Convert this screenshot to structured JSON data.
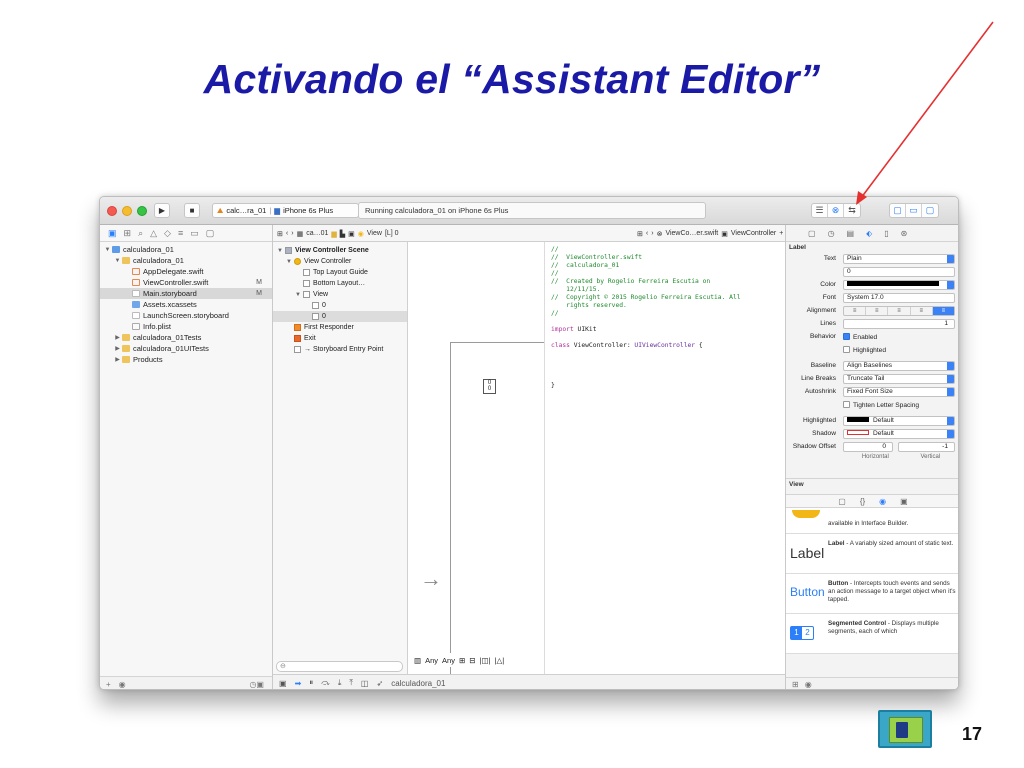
{
  "slide": {
    "title": "Activando el “Assistant Editor”",
    "page_number": "17"
  },
  "toolbar": {
    "scheme_target": "calc…ra_01",
    "device": "iPhone 6s Plus",
    "activity": "Running calculadora_01 on iPhone 6s Plus"
  },
  "navigator": {
    "items": [
      {
        "label": "calculadora_01",
        "indent": 0,
        "icon": "project-icon",
        "toggle": "▼"
      },
      {
        "label": "calculadora_01",
        "indent": 1,
        "icon": "folder-icon",
        "toggle": "▼"
      },
      {
        "label": "AppDelegate.swift",
        "indent": 2,
        "icon": "swift-file-icon",
        "toggle": ""
      },
      {
        "label": "ViewController.swift",
        "indent": 2,
        "icon": "swift-file-icon",
        "toggle": "",
        "flag": "M"
      },
      {
        "label": "Main.storyboard",
        "indent": 2,
        "icon": "storyboard-icon",
        "toggle": "",
        "flag": "M",
        "selected": true
      },
      {
        "label": "Assets.xcassets",
        "indent": 2,
        "icon": "assets-icon",
        "toggle": ""
      },
      {
        "label": "LaunchScreen.storyboard",
        "indent": 2,
        "icon": "storyboard-icon",
        "toggle": ""
      },
      {
        "label": "Info.plist",
        "indent": 2,
        "icon": "plist-icon",
        "toggle": ""
      },
      {
        "label": "calculadora_01Tests",
        "indent": 1,
        "icon": "folder-icon",
        "toggle": "▶"
      },
      {
        "label": "calculadora_01UITests",
        "indent": 1,
        "icon": "folder-icon",
        "toggle": "▶"
      },
      {
        "label": "Products",
        "indent": 1,
        "icon": "folder-icon",
        "toggle": "▶"
      }
    ]
  },
  "jumpbar": {
    "storyboard_crumb": "ca…01",
    "scene_crumb": "View",
    "assistant_file": "ViewCo…er.swift",
    "assistant_class": "ViewController"
  },
  "outline": {
    "items": [
      {
        "label": "View Controller Scene",
        "indent": 0,
        "toggle": "▼",
        "bold": true
      },
      {
        "label": "View Controller",
        "indent": 1,
        "toggle": "▼"
      },
      {
        "label": "Top Layout Guide",
        "indent": 2,
        "toggle": ""
      },
      {
        "label": "Bottom Layout…",
        "indent": 2,
        "toggle": ""
      },
      {
        "label": "View",
        "indent": 2,
        "toggle": "▼"
      },
      {
        "label": "0",
        "indent": 3,
        "toggle": ""
      },
      {
        "label": "0",
        "indent": 3,
        "toggle": "",
        "selected": true
      },
      {
        "label": "First Responder",
        "indent": 1,
        "toggle": ""
      },
      {
        "label": "Exit",
        "indent": 1,
        "toggle": ""
      },
      {
        "label": "→ Storyboard Entry Point",
        "indent": 1,
        "toggle": ""
      }
    ]
  },
  "canvas": {
    "size_class": "Any",
    "size_class_h": "Any"
  },
  "code": [
    {
      "text": "//",
      "kind": "cmt"
    },
    {
      "text": "//  ViewController.swift",
      "kind": "cmt"
    },
    {
      "text": "//  calculadora_01",
      "kind": "cmt"
    },
    {
      "text": "//",
      "kind": "cmt"
    },
    {
      "text": "//  Created by Rogelio Ferreira Escutia on",
      "kind": "cmt"
    },
    {
      "text": "    12/11/15.",
      "kind": "cmt"
    },
    {
      "text": "//  Copyright © 2015 Rogelio Ferreira Escutia. All",
      "kind": "cmt"
    },
    {
      "text": "    rights reserved.",
      "kind": "cmt"
    },
    {
      "text": "//",
      "kind": "cmt"
    },
    {
      "text": "",
      "kind": "kw"
    },
    {
      "text": "import UIKit",
      "kind": "kw"
    },
    {
      "text": "",
      "kind": "kw"
    },
    {
      "text": "class ViewController: UIViewController {",
      "kind": "kw"
    },
    {
      "text": "",
      "kind": "kw"
    },
    {
      "text": "",
      "kind": "kw"
    },
    {
      "text": "",
      "kind": "kw"
    },
    {
      "text": "",
      "kind": "kw"
    },
    {
      "text": "}",
      "kind": "kw"
    }
  ],
  "debugbar": {
    "target": "calculadora_01"
  },
  "inspector": {
    "section": "Label",
    "text": "Plain",
    "text_value": "0",
    "color": "",
    "font": "System 17.0",
    "alignment_label": "Alignment",
    "lines": "1",
    "behavior_enabled": "Enabled",
    "behavior_highlighted": "Highlighted",
    "baseline": "Align Baselines",
    "line_breaks": "Truncate Tail",
    "autoshrink": "Fixed Font Size",
    "tighten": "Tighten Letter Spacing",
    "highlighted": "Default",
    "shadow": "Default",
    "shadow_offset_h": "0",
    "shadow_offset_v": "-1",
    "horizontal": "Horizontal",
    "vertical": "Vertical",
    "view_section": "View",
    "labels": {
      "text": "Text",
      "color": "Color",
      "font": "Font",
      "alignment": "Alignment",
      "lines": "Lines",
      "behavior": "Behavior",
      "baseline": "Baseline",
      "line_breaks": "Line Breaks",
      "autoshrink": "Autoshrink",
      "highlighted": "Highlighted",
      "shadow": "Shadow",
      "shadow_offset": "Shadow Offset"
    }
  },
  "library": [
    {
      "big": "",
      "title": "",
      "desc": "available in Interface Builder."
    },
    {
      "big": "Label",
      "title": "Label",
      "desc": " - A variably sized amount of static text."
    },
    {
      "big": "Button",
      "title": "Button",
      "desc": " - Intercepts touch events and sends an action message to a target object when it's tapped."
    },
    {
      "big": "",
      "title": "Segmented Control",
      "desc": " - Displays multiple segments, each of which"
    }
  ],
  "colors": {
    "title": "#1a1aa6",
    "arrow": "#e53030",
    "accent": "#2d7ff9"
  }
}
